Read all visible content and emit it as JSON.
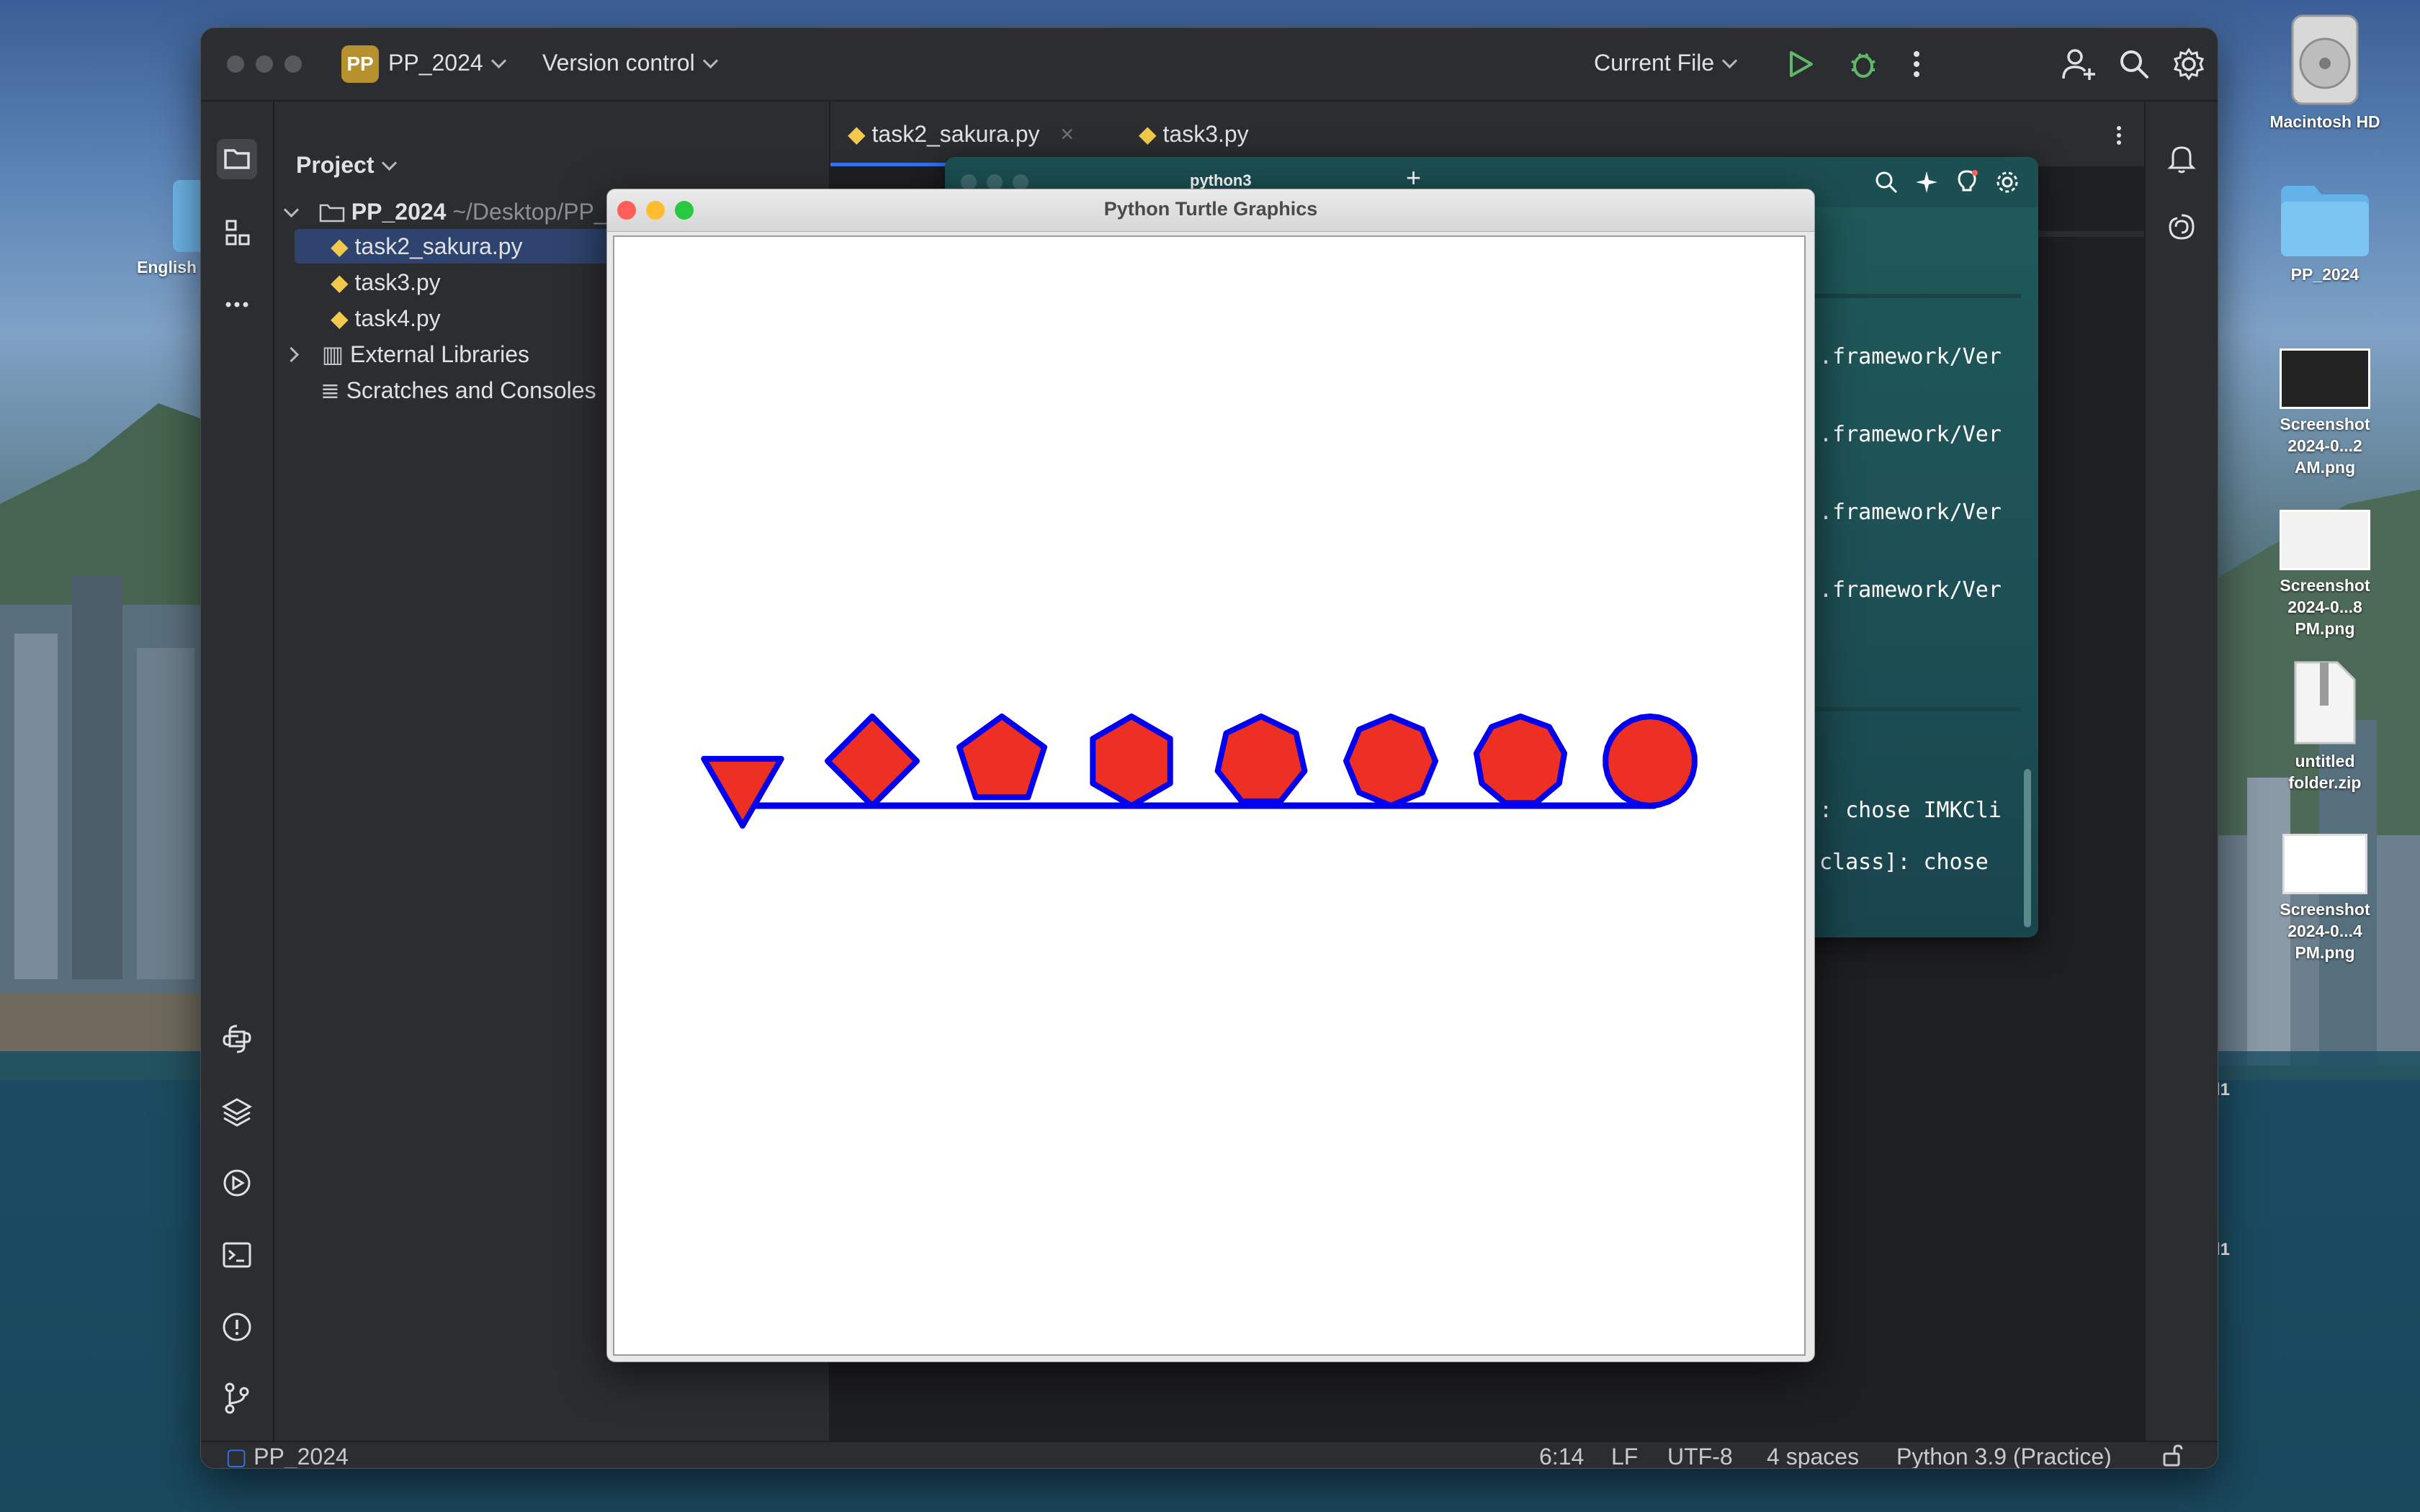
{
  "desktop": {
    "left_icon_label": "English",
    "icons": [
      {
        "name": "Macintosh HD",
        "type": "drive"
      },
      {
        "name": "PP_2024",
        "type": "folder"
      },
      {
        "name": "Screenshot\n2024-0...2 AM.png",
        "line1": "Screenshot",
        "line2": "2024-0...2 AM.png",
        "type": "image"
      },
      {
        "name": "Screenshot\n2024-0...8 PM.png",
        "line1": "Screenshot",
        "line2": "2024-0...8 PM.png",
        "type": "image"
      },
      {
        "name": "untitled folder.zip",
        "type": "zip"
      },
      {
        "name": "Screenshot\n2024-0...4 PM.png",
        "line1": "Screenshot",
        "line2": "2024-0...4 PM.png",
        "type": "image"
      }
    ],
    "side_marks": [
      "l1",
      "l1"
    ]
  },
  "ide": {
    "project_badge": "PP",
    "project_name": "PP_2024",
    "version_control": "Version control",
    "run_config": "Current File",
    "toolbar_icons": [
      "run-icon",
      "debug-icon",
      "more-vertical-icon",
      "add-user-icon",
      "search-icon",
      "settings-icon"
    ],
    "project_panel": {
      "title": "Project",
      "root": {
        "name": "PP_2024",
        "path": "~/Desktop/PP_2024"
      },
      "files": [
        "task2_sakura.py",
        "task3.py",
        "task4.py"
      ],
      "selected_file": "task2_sakura.py",
      "external_libraries": "External Libraries",
      "scratches": "Scratches and Consoles"
    },
    "tabs": [
      {
        "label": "task2_sakura.py",
        "active": true
      },
      {
        "label": "task3.py",
        "active": false
      }
    ],
    "editor_side": {
      "line_count": "2"
    },
    "statusbar": {
      "project": "PP_2024",
      "position": "6:14",
      "line_ending": "LF",
      "encoding": "UTF-8",
      "indent": "4 spaces",
      "interpreter": "Python 3.9 (Practice)"
    }
  },
  "terminal": {
    "title": "python3",
    "lines": [
      ".framework/Ver",
      ".framework/Ver",
      ".framework/Ver",
      ".framework/Ver",
      ": chose IMKCli",
      "class]: chose"
    ]
  },
  "turtle": {
    "title": "Python Turtle Graphics",
    "fill_color": "#ee3024",
    "stroke_color": "#0000ee",
    "shape_sides": [
      3,
      4,
      5,
      6,
      7,
      8,
      9,
      30
    ]
  }
}
